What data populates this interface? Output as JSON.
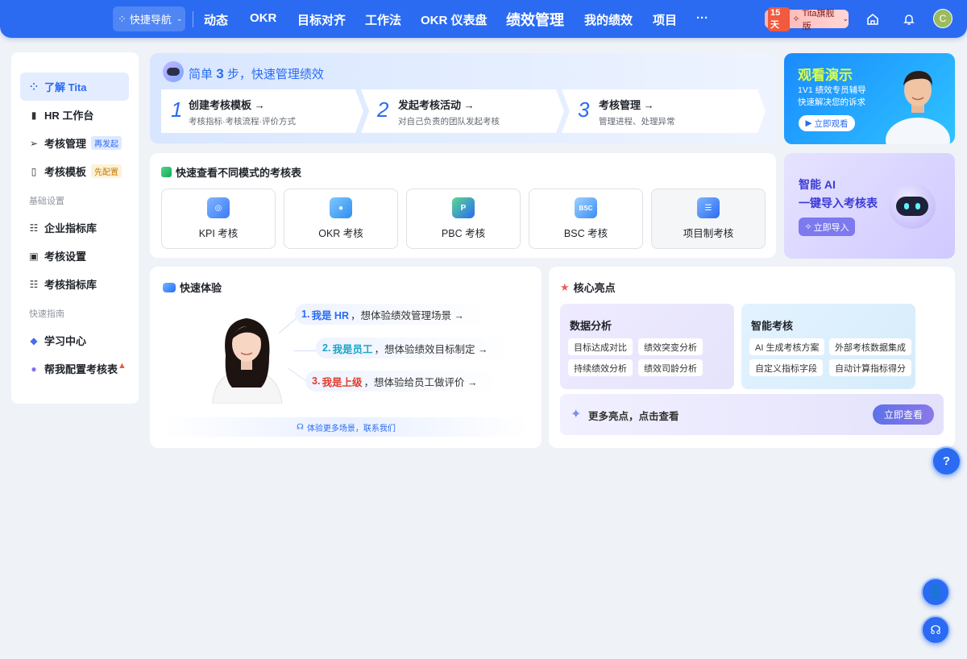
{
  "topnav": {
    "quick_nav": "快捷导航",
    "items": [
      "动态",
      "OKR",
      "目标对齐",
      "工作法",
      "OKR 仪表盘",
      "绩效管理",
      "我的绩效",
      "项目"
    ],
    "active": "绩效管理",
    "more": "···",
    "trial_days": "15天",
    "edition": "Tita旗舰版",
    "avatar_initial": "C"
  },
  "sidebar": {
    "items": [
      {
        "label": "了解 Tita",
        "icon": "grid-icon",
        "active": true
      },
      {
        "label": "HR 工作台",
        "icon": "bar-chart-icon"
      },
      {
        "label": "考核管理",
        "icon": "send-icon",
        "badge": "再发起"
      },
      {
        "label": "考核模板",
        "icon": "template-icon",
        "badge": "先配置"
      }
    ],
    "group_basic": "基础设置",
    "basic_items": [
      {
        "label": "企业指标库",
        "icon": "database-icon"
      },
      {
        "label": "考核设置",
        "icon": "settings-doc-icon"
      },
      {
        "label": "考核指标库",
        "icon": "database-icon"
      }
    ],
    "group_guide": "快速指南",
    "guide_items": [
      {
        "label": "学习中心",
        "icon": "book-icon"
      },
      {
        "label": "帮我配置考核表",
        "icon": "assistant-icon"
      }
    ]
  },
  "steps": {
    "title_prefix": "简单",
    "title_num": "3",
    "title_suffix": "步，快速管理绩效",
    "items": [
      {
        "num": "1",
        "title": "创建考核模板",
        "desc": "考核指标·考核流程·评价方式"
      },
      {
        "num": "2",
        "title": "发起考核活动",
        "desc": "对自己负责的团队发起考核"
      },
      {
        "num": "3",
        "title": "考核管理",
        "desc": "管理进程、处理异常"
      }
    ]
  },
  "promo_demo": {
    "title": "观看演示",
    "line1": "1V1 绩效专员辅导",
    "line2": "快速解决您的诉求",
    "button": "立即观看"
  },
  "modes": {
    "title": "快速查看不同模式的考核表",
    "items": [
      "KPI 考核",
      "OKR 考核",
      "PBC 考核",
      "BSC 考核",
      "项目制考核"
    ]
  },
  "promo_ai": {
    "line1": "智能 AI",
    "line2": "一键导入考核表",
    "button": "立即导入"
  },
  "experience": {
    "title": "快速体验",
    "options": [
      {
        "num": "1.",
        "role": "我是 HR",
        "text": "想体验绩效管理场景 →"
      },
      {
        "num": "2.",
        "role": "我是员工",
        "text": "想体验绩效目标制定 →"
      },
      {
        "num": "3.",
        "role": "我是上级",
        "text": "想体验给员工做评价 →"
      }
    ],
    "footer": "体验更多场景，联系我们"
  },
  "highlights": {
    "title": "核心亮点",
    "data_analysis": {
      "title": "数据分析",
      "chips": [
        "目标达成对比",
        "绩效突变分析",
        "持续绩效分析",
        "绩效司龄分析"
      ]
    },
    "smart_review": {
      "title": "智能考核",
      "chips": [
        "AI 生成考核方案",
        "外部考核数据集成",
        "自定义指标字段",
        "自动计算指标得分"
      ]
    },
    "more": "更多亮点，点击查看",
    "more_button": "立即查看"
  },
  "colors": {
    "brand": "#2a6bf2",
    "hr_role": "#2a6bf2",
    "employee_role": "#19a7c9",
    "manager_role": "#e23c2c"
  }
}
